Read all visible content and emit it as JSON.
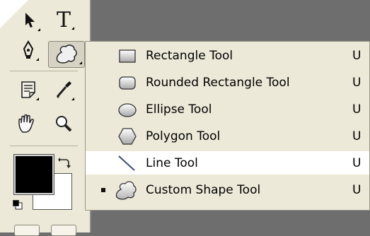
{
  "toolbox": {
    "tools": [
      {
        "name": "move-arrow-icon"
      },
      {
        "name": "type-tool-icon",
        "glyph": "T"
      },
      {
        "name": "pen-tool-icon"
      },
      {
        "name": "custom-shape-tool-icon",
        "active": true
      },
      {
        "name": "notes-tool-icon"
      },
      {
        "name": "eyedropper-icon"
      },
      {
        "name": "hand-tool-icon"
      },
      {
        "name": "zoom-icon"
      }
    ],
    "colors": {
      "foreground": "#000000",
      "background": "#ffffff"
    }
  },
  "flyout": {
    "items": [
      {
        "label": "Rectangle Tool",
        "shortcut": "U",
        "icon": "rectangle-icon",
        "selected": false,
        "highlighted": false
      },
      {
        "label": "Rounded Rectangle Tool",
        "shortcut": "U",
        "icon": "rounded-rectangle-icon",
        "selected": false,
        "highlighted": false
      },
      {
        "label": "Ellipse Tool",
        "shortcut": "U",
        "icon": "ellipse-icon",
        "selected": false,
        "highlighted": false
      },
      {
        "label": "Polygon Tool",
        "shortcut": "U",
        "icon": "polygon-icon",
        "selected": false,
        "highlighted": false
      },
      {
        "label": "Line Tool",
        "shortcut": "U",
        "icon": "line-icon",
        "selected": false,
        "highlighted": true
      },
      {
        "label": "Custom Shape Tool",
        "shortcut": "U",
        "icon": "custom-shape-icon",
        "selected": true,
        "highlighted": false
      }
    ]
  }
}
